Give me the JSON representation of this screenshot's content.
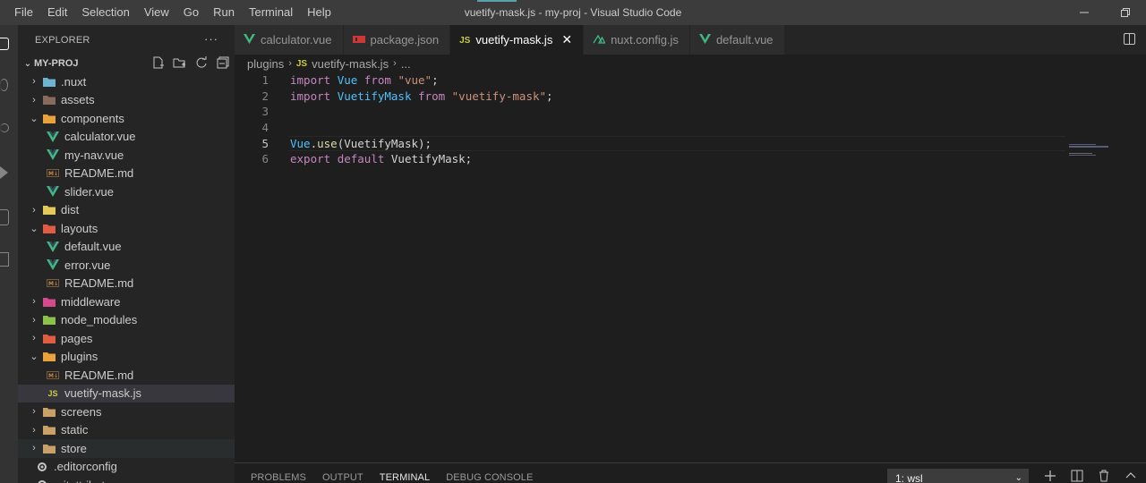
{
  "menu": [
    "File",
    "Edit",
    "Selection",
    "View",
    "Go",
    "Run",
    "Terminal",
    "Help"
  ],
  "window_title": "vuetify-mask.js - my-proj - Visual Studio Code",
  "window_controls": {
    "minimize": "—",
    "restore": "❐"
  },
  "explorer": {
    "header": "EXPLORER",
    "more": "···",
    "section": "MY-PROJ",
    "items": [
      {
        "label": ".nuxt",
        "type": "folder",
        "depth": 0,
        "expanded": false,
        "icon_color": "#6fb3d2"
      },
      {
        "label": "assets",
        "type": "folder",
        "depth": 0,
        "expanded": false,
        "icon_color": "#8a6a5c"
      },
      {
        "label": "components",
        "type": "folder",
        "depth": 0,
        "expanded": true,
        "icon_color": "#e8a33c"
      },
      {
        "label": "calculator.vue",
        "type": "vue",
        "depth": 1
      },
      {
        "label": "my-nav.vue",
        "type": "vue",
        "depth": 1
      },
      {
        "label": "README.md",
        "type": "md",
        "depth": 1
      },
      {
        "label": "slider.vue",
        "type": "vue",
        "depth": 1
      },
      {
        "label": "dist",
        "type": "folder",
        "depth": 0,
        "expanded": false,
        "icon_color": "#e3c85a"
      },
      {
        "label": "layouts",
        "type": "folder",
        "depth": 0,
        "expanded": true,
        "icon_color": "#e05d44"
      },
      {
        "label": "default.vue",
        "type": "vue",
        "depth": 1
      },
      {
        "label": "error.vue",
        "type": "vue",
        "depth": 1
      },
      {
        "label": "README.md",
        "type": "md",
        "depth": 1
      },
      {
        "label": "middleware",
        "type": "folder",
        "depth": 0,
        "expanded": false,
        "icon_color": "#d44a8a"
      },
      {
        "label": "node_modules",
        "type": "folder",
        "depth": 0,
        "expanded": false,
        "icon_color": "#8bc34a"
      },
      {
        "label": "pages",
        "type": "folder",
        "depth": 0,
        "expanded": false,
        "icon_color": "#e05d44"
      },
      {
        "label": "plugins",
        "type": "folder",
        "depth": 0,
        "expanded": true,
        "icon_color": "#e8a33c"
      },
      {
        "label": "README.md",
        "type": "md",
        "depth": 1
      },
      {
        "label": "vuetify-mask.js",
        "type": "js",
        "depth": 1,
        "selected": true
      },
      {
        "label": "screens",
        "type": "folder",
        "depth": 0,
        "expanded": false,
        "icon_color": "#c9a066"
      },
      {
        "label": "static",
        "type": "folder",
        "depth": 0,
        "expanded": false,
        "icon_color": "#c9a066"
      },
      {
        "label": "store",
        "type": "folder",
        "depth": 0,
        "expanded": false,
        "icon_color": "#c9a066",
        "hover": true
      },
      {
        "label": ".editorconfig",
        "type": "config",
        "depth": 0
      },
      {
        "label": ".gitattributes",
        "type": "config",
        "depth": 0
      }
    ]
  },
  "tabs": [
    {
      "label": "calculator.vue",
      "icon": "vue",
      "active": false
    },
    {
      "label": "package.json",
      "icon": "npm",
      "active": false
    },
    {
      "label": "vuetify-mask.js",
      "icon": "js",
      "active": true
    },
    {
      "label": "nuxt.config.js",
      "icon": "nuxt",
      "active": false
    },
    {
      "label": "default.vue",
      "icon": "vue",
      "active": false
    }
  ],
  "breadcrumb": {
    "folder": "plugins",
    "file_icon": "JS",
    "file": "vuetify-mask.js",
    "ellipsis": "..."
  },
  "code": {
    "current_line": 5,
    "lines": [
      {
        "n": "1",
        "tokens": [
          [
            "kw",
            "import"
          ],
          [
            "plain",
            " "
          ],
          [
            "id",
            "Vue"
          ],
          [
            "plain",
            " "
          ],
          [
            "kw",
            "from"
          ],
          [
            "plain",
            " "
          ],
          [
            "str",
            "\"vue\""
          ],
          [
            "plain",
            ";"
          ]
        ]
      },
      {
        "n": "2",
        "tokens": [
          [
            "kw",
            "import"
          ],
          [
            "plain",
            " "
          ],
          [
            "id",
            "VuetifyMask"
          ],
          [
            "plain",
            " "
          ],
          [
            "kw",
            "from"
          ],
          [
            "plain",
            " "
          ],
          [
            "str",
            "\"vuetify-mask\""
          ],
          [
            "plain",
            ";"
          ]
        ]
      },
      {
        "n": "3",
        "tokens": []
      },
      {
        "n": "4",
        "tokens": []
      },
      {
        "n": "5",
        "tokens": [
          [
            "id",
            "Vue"
          ],
          [
            "plain",
            "."
          ],
          [
            "fn",
            "use"
          ],
          [
            "plain",
            "(VuetifyMask);"
          ]
        ]
      },
      {
        "n": "6",
        "tokens": [
          [
            "kw",
            "export"
          ],
          [
            "plain",
            " "
          ],
          [
            "kw",
            "default"
          ],
          [
            "plain",
            " VuetifyMask;"
          ]
        ]
      }
    ]
  },
  "panel": {
    "tabs": [
      {
        "label": "PROBLEMS",
        "active": false
      },
      {
        "label": "OUTPUT",
        "active": false
      },
      {
        "label": "TERMINAL",
        "active": true
      },
      {
        "label": "DEBUG CONSOLE",
        "active": false
      }
    ],
    "terminal_select": "1: wsl",
    "tools": [
      "plus-icon",
      "split-terminal-icon",
      "trash-icon",
      "chevron-up-icon"
    ]
  }
}
